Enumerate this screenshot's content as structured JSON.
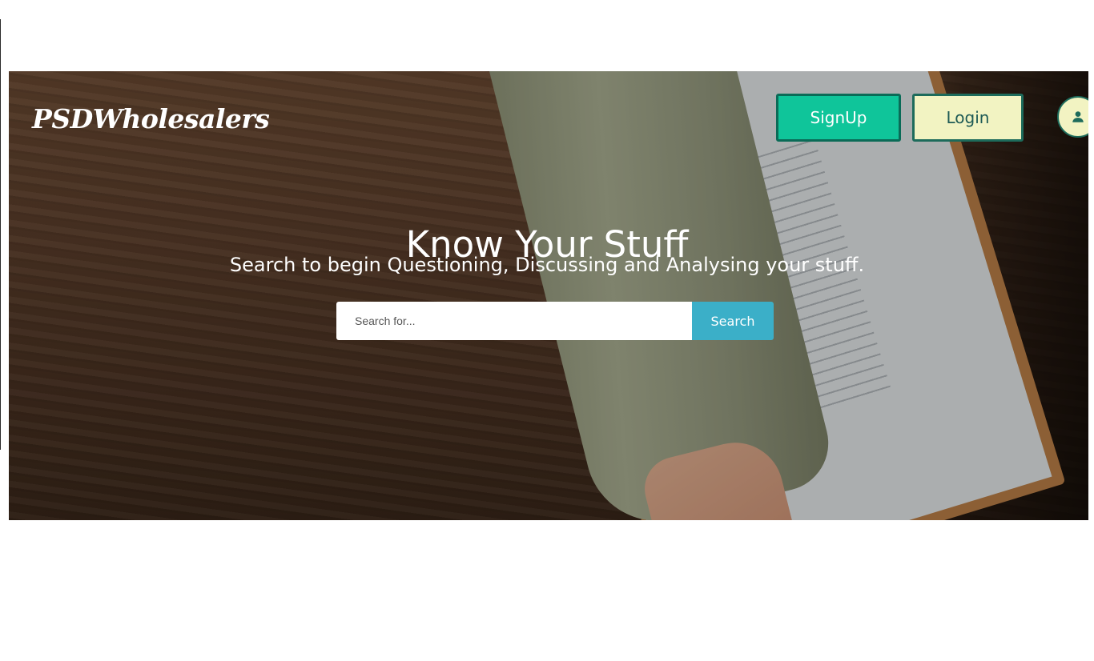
{
  "header": {
    "logo_text": "PSDWholesalers",
    "signup_label": "SignUp",
    "login_label": "Login",
    "avatar_icon": "user-icon"
  },
  "hero": {
    "title": "Know Your Stuff",
    "subtitle": "Search to begin Questioning, Discussing and Analysing your stuff.",
    "background_image": "wooden-desk-contract-photo"
  },
  "search": {
    "placeholder": "Search for...",
    "value": "",
    "button_label": "Search"
  },
  "colors": {
    "signup_bg": "#0fc59a",
    "login_bg": "#f2f3c2",
    "search_button_bg": "#3bafc8",
    "border_accent": "#1d6b5b"
  }
}
